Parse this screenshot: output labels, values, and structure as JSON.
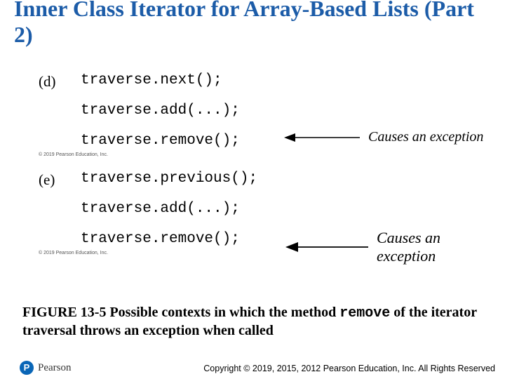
{
  "title": "Inner Class Iterator for Array-Based Lists (Part 2)",
  "blocks": {
    "d": {
      "label": "(d)",
      "line1": "traverse.next();",
      "line2": "traverse.add(...);",
      "line3": "traverse.remove();",
      "arrow_caption": "Causes an exception",
      "tiny": "© 2019 Pearson Education, Inc."
    },
    "e": {
      "label": "(e)",
      "line1": "traverse.previous();",
      "line2": "traverse.add(...);",
      "line3": "traverse.remove();",
      "arrow_caption": "Causes an exception",
      "tiny": "© 2019 Pearson Education, Inc."
    }
  },
  "figure_caption": {
    "prefix": "FIGURE 13-5 Possible contexts in which the method ",
    "mono": "remove",
    "suffix": " of the iterator traversal throws an exception when called"
  },
  "footer": {
    "pearson_letter": "P",
    "pearson_name": "Pearson",
    "copyright": "Copyright © 2019, 2015, 2012 Pearson Education, Inc. All Rights Reserved"
  }
}
